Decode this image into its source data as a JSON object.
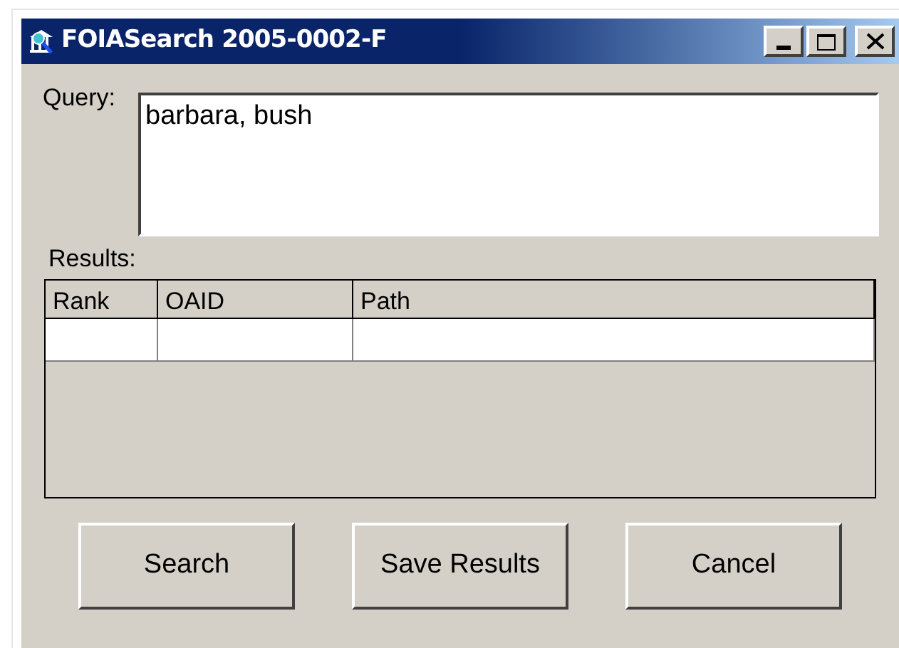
{
  "window": {
    "title": "FOIASearch 2005-0002-F"
  },
  "query": {
    "label": "Query:",
    "value": "barbara, bush"
  },
  "results": {
    "label": "Results:",
    "columns": [
      "Rank",
      "OAID",
      "Path"
    ]
  },
  "buttons": [
    "Search",
    "Save Results",
    "Cancel"
  ]
}
